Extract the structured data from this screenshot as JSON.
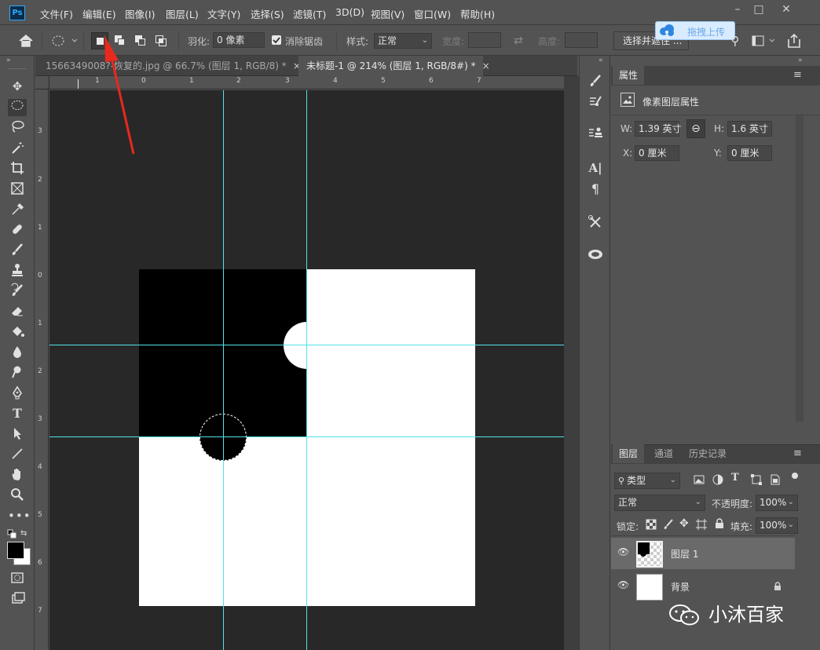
{
  "app": {
    "logo": "Ps",
    "accent": "#31a8ff"
  },
  "menus": [
    "文件(F)",
    "编辑(E)",
    "图像(I)",
    "图层(L)",
    "文字(Y)",
    "选择(S)",
    "滤镜(T)",
    "3D(D)",
    "视图(V)",
    "窗口(W)",
    "帮助(H)"
  ],
  "window_controls": {
    "minimize": "–",
    "maximize": "□",
    "close": "✕"
  },
  "options": {
    "feather_label": "羽化:",
    "feather_value": "0 像素",
    "antialias_label": "消除锯齿",
    "antialias_checked": true,
    "style_label": "样式:",
    "style_value": "正常",
    "width_label": "宽度:",
    "height_label": "高度:",
    "select_mask_button": "选择并遮住 ...",
    "upload_badge": "拖拽上传"
  },
  "tabs": [
    {
      "label": "1566349008?-恢复的.jpg @ 66.7% (图层 1, RGB/8) *",
      "close": "×",
      "active": false
    },
    {
      "label": "未标题-1 @ 214% (图层 1, RGB/8#) *",
      "close": "×",
      "active": true
    }
  ],
  "rulers": {
    "top": [
      "1",
      "0",
      "1",
      "2",
      "3",
      "4",
      "5",
      "6",
      "7"
    ],
    "left": [
      "3",
      "2",
      "1",
      "0",
      "1",
      "2",
      "3",
      "4",
      "5",
      "6",
      "7"
    ]
  },
  "tools": [
    "move-tool",
    "ellipse-marquee-tool",
    "lasso-tool",
    "magic-wand-tool",
    "crop-tool",
    "frame-tool",
    "eyedropper-tool",
    "healing-brush-tool",
    "brush-tool",
    "clone-stamp-tool",
    "history-brush-tool",
    "eraser-tool",
    "paint-bucket-tool",
    "blur-tool",
    "dodge-tool",
    "pen-tool",
    "type-tool",
    "path-selection-tool",
    "line-tool",
    "hand-tool",
    "zoom-tool",
    "more-tools"
  ],
  "colors": {
    "foreground": "#000000",
    "background": "#ffffff",
    "guide": "#4fe3e8",
    "pasteboard": "#282828"
  },
  "properties": {
    "tab_label": "属性",
    "section_title": "像素图层属性",
    "w_label": "W:",
    "w_value": "1.39 英寸",
    "h_label": "H:",
    "h_value": "1.6 英寸",
    "x_label": "X:",
    "x_value": "0 厘米",
    "y_label": "Y:",
    "y_value": "0 厘米"
  },
  "layers_panel": {
    "tabs": [
      "图层",
      "通道",
      "历史记录"
    ],
    "filter_label": "类型",
    "blend_mode": "正常",
    "opacity_label": "不透明度:",
    "opacity_value": "100%",
    "lock_label": "锁定:",
    "fill_label": "填充:",
    "fill_value": "100%",
    "layers": [
      {
        "name": "图层 1",
        "selected": true
      },
      {
        "name": "背景",
        "selected": false,
        "locked": true
      }
    ]
  },
  "watermark": "小沐百家"
}
